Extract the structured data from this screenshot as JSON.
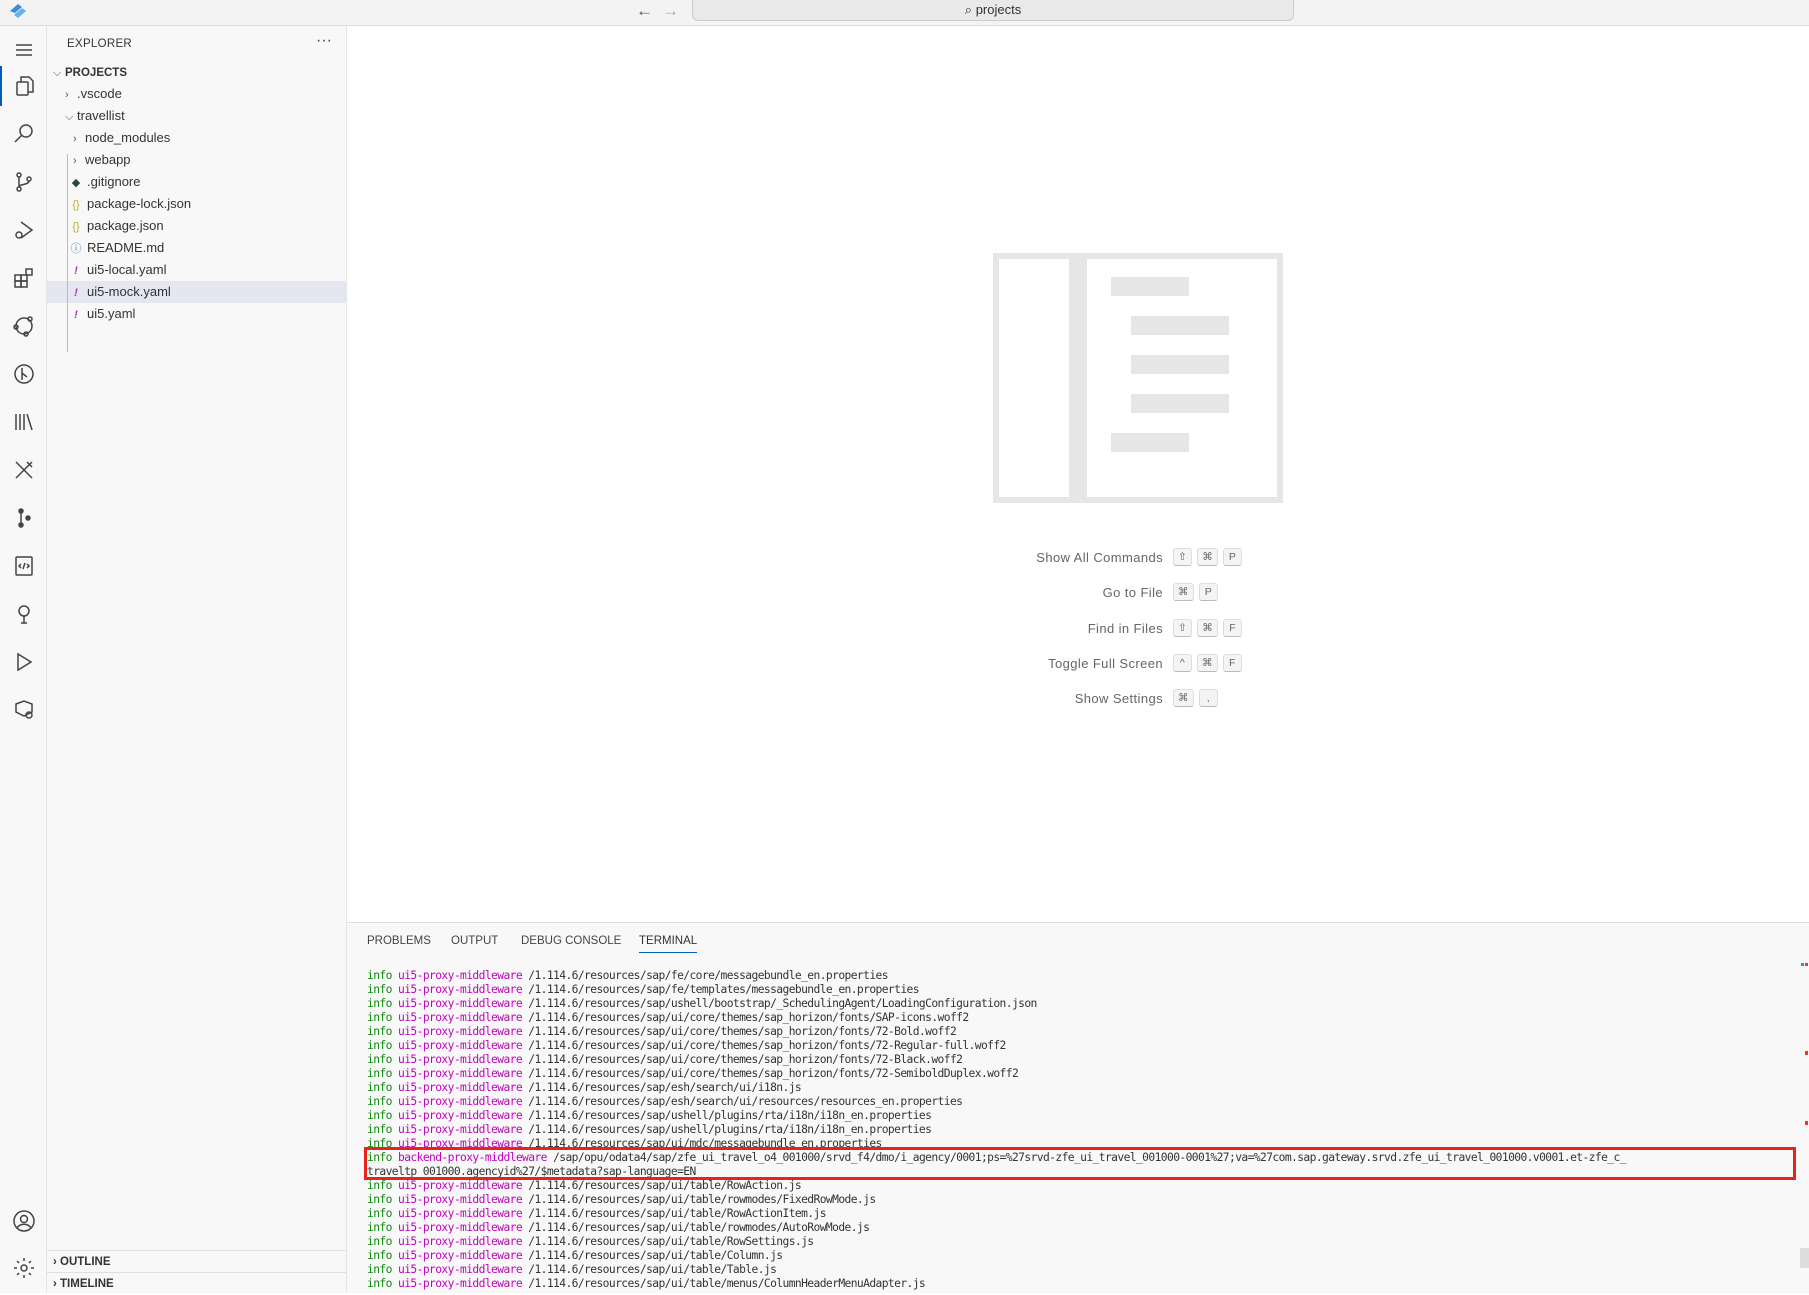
{
  "titlebar": {
    "search_text": "projects",
    "back_icon": "arrow-left-icon",
    "forward_icon": "arrow-right-icon"
  },
  "sidebar": {
    "title": "EXPLORER",
    "more": "···",
    "root": "PROJECTS",
    "items": [
      {
        "label": ".vscode",
        "type": "folder",
        "expanded": false
      },
      {
        "label": "travellist",
        "type": "folder",
        "expanded": true
      },
      {
        "label": "node_modules",
        "type": "folder",
        "expanded": false
      },
      {
        "label": "webapp",
        "type": "folder",
        "expanded": false
      },
      {
        "label": ".gitignore",
        "type": "file",
        "icon": "git-icon"
      },
      {
        "label": "package-lock.json",
        "type": "file",
        "icon": "json-icon"
      },
      {
        "label": "package.json",
        "type": "file",
        "icon": "json-icon"
      },
      {
        "label": "README.md",
        "type": "file",
        "icon": "info-icon"
      },
      {
        "label": "ui5-local.yaml",
        "type": "file",
        "icon": "yaml-icon"
      },
      {
        "label": "ui5-mock.yaml",
        "type": "file",
        "icon": "yaml-icon",
        "selected": true
      },
      {
        "label": "ui5.yaml",
        "type": "file",
        "icon": "yaml-icon"
      }
    ],
    "outline": "OUTLINE",
    "timeline": "TIMELINE"
  },
  "editor": {
    "commands": [
      {
        "label": "Show All Commands",
        "keys": [
          "⇧",
          "⌘",
          "P"
        ]
      },
      {
        "label": "Go to File",
        "keys": [
          "⌘",
          "P"
        ]
      },
      {
        "label": "Find in Files",
        "keys": [
          "⇧",
          "⌘",
          "F"
        ]
      },
      {
        "label": "Toggle Full Screen",
        "keys": [
          "^",
          "⌘",
          "F"
        ]
      },
      {
        "label": "Show Settings",
        "keys": [
          "⌘",
          ","
        ]
      }
    ]
  },
  "panel": {
    "tabs": [
      "PROBLEMS",
      "OUTPUT",
      "DEBUG CONSOLE",
      "TERMINAL"
    ],
    "active_tab": "TERMINAL",
    "lines": [
      {
        "level": "info",
        "source": "ui5-proxy-middleware",
        "path": "/1.114.6/resources/sap/fe/core/messagebundle_en.properties"
      },
      {
        "level": "info",
        "source": "ui5-proxy-middleware",
        "path": "/1.114.6/resources/sap/fe/templates/messagebundle_en.properties"
      },
      {
        "level": "info",
        "source": "ui5-proxy-middleware",
        "path": "/1.114.6/resources/sap/ushell/bootstrap/_SchedulingAgent/LoadingConfiguration.json"
      },
      {
        "level": "info",
        "source": "ui5-proxy-middleware",
        "path": "/1.114.6/resources/sap/ui/core/themes/sap_horizon/fonts/SAP-icons.woff2"
      },
      {
        "level": "info",
        "source": "ui5-proxy-middleware",
        "path": "/1.114.6/resources/sap/ui/core/themes/sap_horizon/fonts/72-Bold.woff2"
      },
      {
        "level": "info",
        "source": "ui5-proxy-middleware",
        "path": "/1.114.6/resources/sap/ui/core/themes/sap_horizon/fonts/72-Regular-full.woff2"
      },
      {
        "level": "info",
        "source": "ui5-proxy-middleware",
        "path": "/1.114.6/resources/sap/ui/core/themes/sap_horizon/fonts/72-Black.woff2"
      },
      {
        "level": "info",
        "source": "ui5-proxy-middleware",
        "path": "/1.114.6/resources/sap/ui/core/themes/sap_horizon/fonts/72-SemiboldDuplex.woff2"
      },
      {
        "level": "info",
        "source": "ui5-proxy-middleware",
        "path": "/1.114.6/resources/sap/esh/search/ui/i18n.js"
      },
      {
        "level": "info",
        "source": "ui5-proxy-middleware",
        "path": "/1.114.6/resources/sap/esh/search/ui/resources/resources_en.properties"
      },
      {
        "level": "info",
        "source": "ui5-proxy-middleware",
        "path": "/1.114.6/resources/sap/ushell/plugins/rta/i18n/i18n_en.properties"
      },
      {
        "level": "info",
        "source": "ui5-proxy-middleware",
        "path": "/1.114.6/resources/sap/ushell/plugins/rta/i18n/i18n_en.properties"
      },
      {
        "level": "info",
        "source": "ui5-proxy-middleware",
        "path": "/1.114.6/resources/sap/ui/mdc/messagebundle_en.properties"
      },
      {
        "level": "info",
        "source": "backend-proxy-middleware",
        "path": "/sap/opu/odata4/sap/zfe_ui_travel_o4_001000/srvd_f4/dmo/i_agency/0001;ps=%27srvd-zfe_ui_travel_001000-0001%27;va=%27com.sap.gateway.srvd.zfe_ui_travel_001000.v0001.et-zfe_c_\ntraveltp_001000.agencyid%27/$metadata?sap-language=EN",
        "highlighted": true
      },
      {
        "level": "info",
        "source": "ui5-proxy-middleware",
        "path": "/1.114.6/resources/sap/ui/table/RowAction.js"
      },
      {
        "level": "info",
        "source": "ui5-proxy-middleware",
        "path": "/1.114.6/resources/sap/ui/table/rowmodes/FixedRowMode.js"
      },
      {
        "level": "info",
        "source": "ui5-proxy-middleware",
        "path": "/1.114.6/resources/sap/ui/table/RowActionItem.js"
      },
      {
        "level": "info",
        "source": "ui5-proxy-middleware",
        "path": "/1.114.6/resources/sap/ui/table/rowmodes/AutoRowMode.js"
      },
      {
        "level": "info",
        "source": "ui5-proxy-middleware",
        "path": "/1.114.6/resources/sap/ui/table/RowSettings.js"
      },
      {
        "level": "info",
        "source": "ui5-proxy-middleware",
        "path": "/1.114.6/resources/sap/ui/table/Column.js"
      },
      {
        "level": "info",
        "source": "ui5-proxy-middleware",
        "path": "/1.114.6/resources/sap/ui/table/Table.js"
      },
      {
        "level": "info",
        "source": "ui5-proxy-middleware",
        "path": "/1.114.6/resources/sap/ui/table/menus/ColumnHeaderMenuAdapter.js"
      }
    ]
  },
  "colors": {
    "accent": "#005fb8",
    "highlight_box": "#e8221c",
    "log_level": "#118811",
    "log_source": "#bc05bc"
  }
}
